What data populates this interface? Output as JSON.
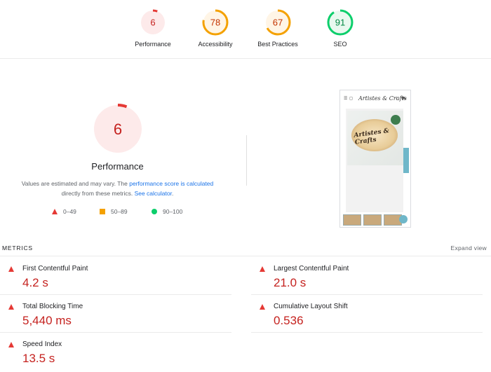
{
  "gauges": [
    {
      "label": "Performance",
      "score": "6",
      "fraction": 0.06,
      "color": "#e53935",
      "fill": "#fdeaea",
      "text_color": "#c5221f"
    },
    {
      "label": "Accessibility",
      "score": "78",
      "fraction": 0.78,
      "color": "#f4a100",
      "fill": "#fff5e6",
      "text_color": "#c33300"
    },
    {
      "label": "Best Practices",
      "score": "67",
      "fraction": 0.67,
      "color": "#f4a100",
      "fill": "#fff5e6",
      "text_color": "#c33300"
    },
    {
      "label": "SEO",
      "score": "91",
      "fraction": 0.91,
      "color": "#0cce6b",
      "fill": "#e9f9ef",
      "text_color": "#018642"
    }
  ],
  "hero": {
    "score": "6",
    "fraction": 0.06,
    "title": "Performance",
    "desc_before": "Values are estimated and may vary. The ",
    "link_score": "performance score is calculated",
    "desc_mid": " directly from these metrics. ",
    "link_calc": "See calculator",
    "desc_end": "."
  },
  "legend": {
    "fail": "0–49",
    "average": "50–89",
    "pass": "90–100"
  },
  "screenshot": {
    "logo_text": "Artistes & Crafts",
    "wood_text": "Artistes & Crafts"
  },
  "metrics": {
    "title": "METRICS",
    "expand": "Expand view",
    "items": [
      {
        "label": "First Contentful Paint",
        "value": "4.2 s"
      },
      {
        "label": "Largest Contentful Paint",
        "value": "21.0 s"
      },
      {
        "label": "Total Blocking Time",
        "value": "5,440 ms"
      },
      {
        "label": "Cumulative Layout Shift",
        "value": "0.536"
      },
      {
        "label": "Speed Index",
        "value": "13.5 s"
      }
    ]
  },
  "colors": {
    "fail": "#e53935",
    "average": "#f4a100",
    "pass": "#0cce6b",
    "link": "#1a73e8",
    "fail_text": "#c5221f"
  }
}
